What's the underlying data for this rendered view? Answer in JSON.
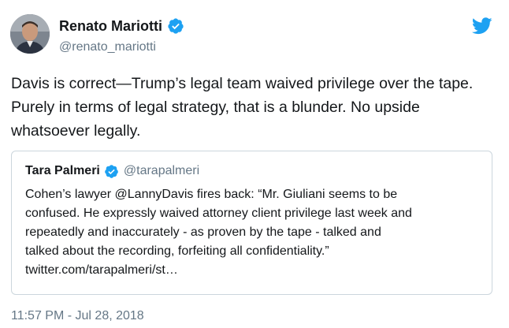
{
  "author": {
    "name": "Renato Mariotti",
    "handle": "@renato_mariotti",
    "avatar_icon": "user-avatar-photo",
    "verified": true
  },
  "tweet": {
    "text": "Davis is correct—Trump’s legal team waived privilege over the tape. Purely in terms of legal strategy, that is a blunder. No upside whatsoever legally.",
    "timestamp": "11:57 PM - Jul 28, 2018"
  },
  "quoted_tweet": {
    "name": "Tara Palmeri",
    "handle": "@tarapalmeri",
    "verified": true,
    "lines": [
      "Cohen’s lawyer @LannyDavis fires back: “Mr. Giuliani seems to be",
      "confused. He expressly waived attorney client privilege  last week and",
      "repeatedly and inaccurately - as proven by the tape - talked and",
      "talked about the recording, forfeiting all confidentiality.”",
      "twitter.com/tarapalmeri/st…"
    ]
  },
  "icons": {
    "brand": "twitter-bird-icon",
    "verified": "verified-badge-icon"
  },
  "colors": {
    "twitter_blue": "#1da1f2",
    "text_primary": "#14171a",
    "text_secondary": "#657786",
    "border": "#ccd6dd"
  }
}
